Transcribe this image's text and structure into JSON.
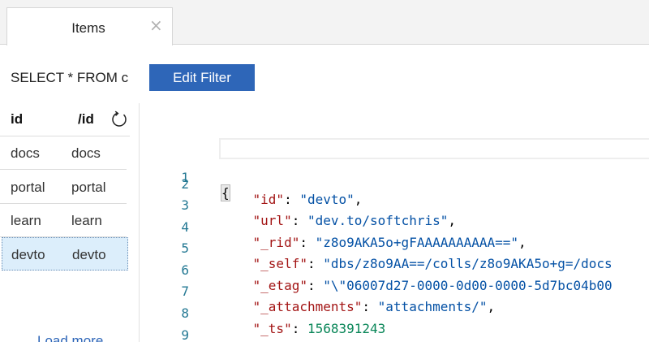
{
  "tabs": [
    {
      "label": "Items",
      "close": "×"
    }
  ],
  "query": {
    "text": "SELECT * FROM c",
    "edit_filter_label": "Edit Filter"
  },
  "list": {
    "headers": {
      "id": "id",
      "pk": "/id"
    },
    "rows": [
      {
        "id": "docs",
        "pk": "docs"
      },
      {
        "id": "portal",
        "pk": "portal"
      },
      {
        "id": "learn",
        "pk": "learn"
      },
      {
        "id": "devto",
        "pk": "devto"
      }
    ],
    "selected_index": 3,
    "load_more": "Load more"
  },
  "editor": {
    "line_numbers": [
      "1",
      "2",
      "3",
      "4",
      "5",
      "6",
      "7",
      "8",
      "9"
    ],
    "open_brace": "{",
    "close_brace": "}",
    "fields": [
      {
        "key": "\"id\"",
        "value": "\"devto\"",
        "suffix": ","
      },
      {
        "key": "\"url\"",
        "value": "\"dev.to/softchris\"",
        "suffix": ","
      },
      {
        "key": "\"_rid\"",
        "value": "\"z8o9AKA5o+gFAAAAAAAAAA==\"",
        "suffix": ","
      },
      {
        "key": "\"_self\"",
        "value": "\"dbs/z8o9AA==/colls/z8o9AKA5o+g=/docs",
        "suffix": ""
      },
      {
        "key": "\"_etag\"",
        "value": "\"\\\"06007d27-0000-0d00-0000-5d7bc04b00",
        "suffix": ""
      },
      {
        "key": "\"_attachments\"",
        "value": "\"attachments/\"",
        "suffix": ","
      },
      {
        "key": "\"_ts\"",
        "value": "1568391243",
        "suffix": ""
      }
    ]
  },
  "colors": {
    "accent": "#2e66b8",
    "selected_row": "#dceefb",
    "json_key": "#a31515",
    "json_string": "#0451a5",
    "json_number": "#098658",
    "line_number": "#237893"
  }
}
